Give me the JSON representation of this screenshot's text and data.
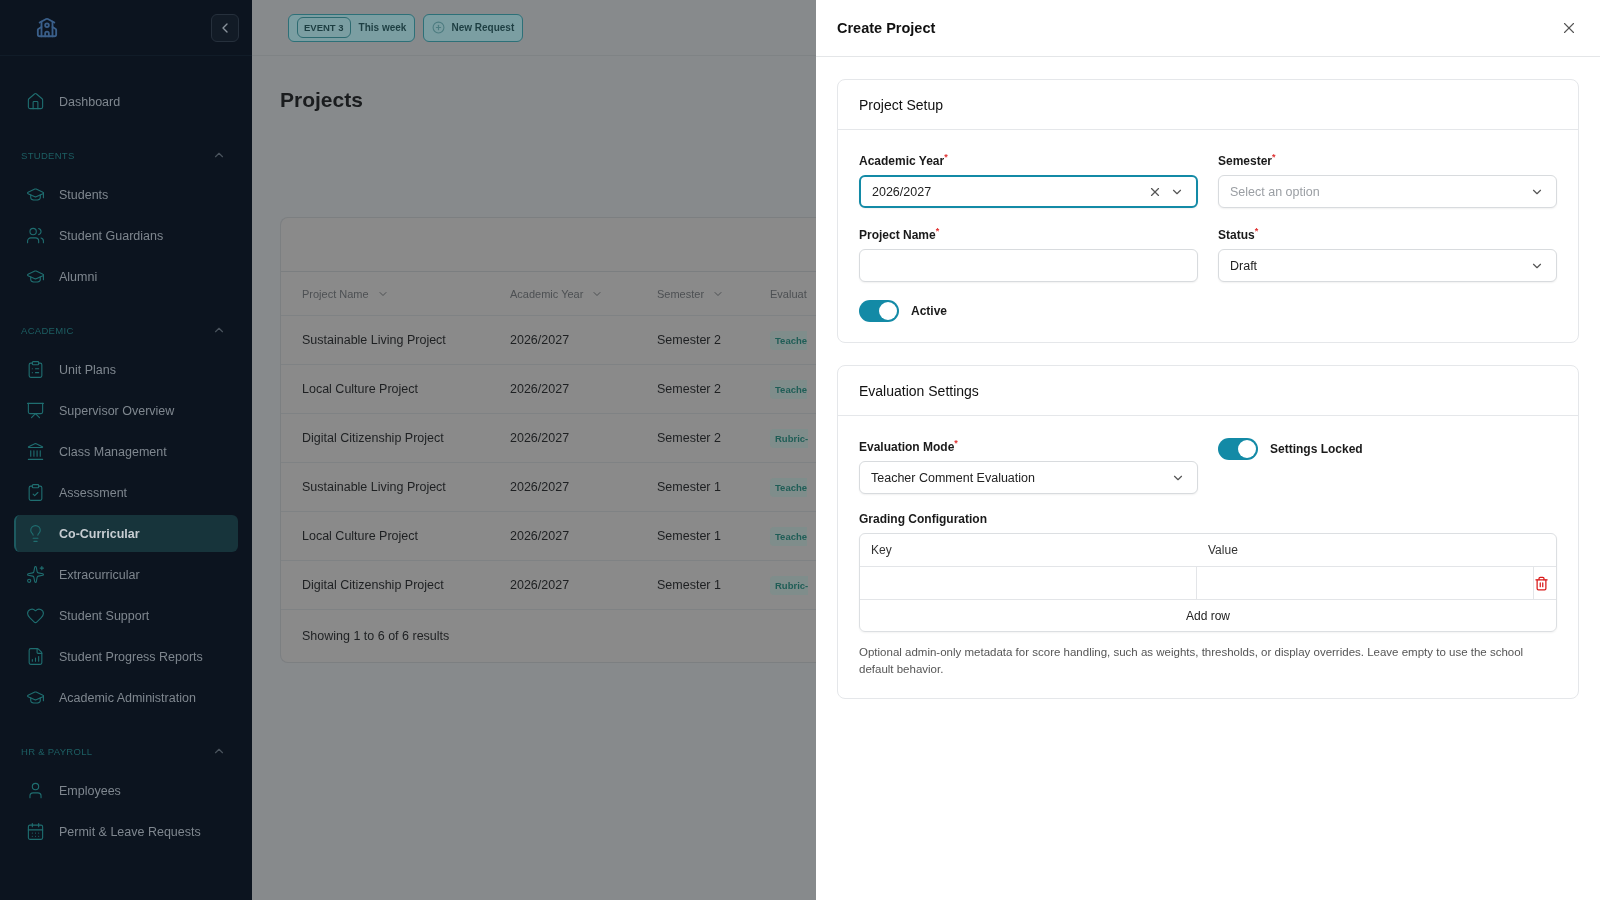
{
  "sidebar": {
    "top_items": [
      {
        "label": "Dashboard",
        "selected": false
      }
    ],
    "sections": [
      {
        "title": "STUDENTS",
        "expanded": true,
        "items": [
          {
            "label": "Students",
            "selected": false
          },
          {
            "label": "Student Guardians",
            "selected": false
          },
          {
            "label": "Alumni",
            "selected": false
          }
        ]
      },
      {
        "title": "ACADEMIC",
        "expanded": true,
        "items": [
          {
            "label": "Unit Plans",
            "selected": false
          },
          {
            "label": "Supervisor Overview",
            "selected": false
          },
          {
            "label": "Class Management",
            "selected": false
          },
          {
            "label": "Assessment",
            "selected": false
          },
          {
            "label": "Co-Curricular",
            "selected": true
          },
          {
            "label": "Extracurricular",
            "selected": false
          },
          {
            "label": "Student Support",
            "selected": false
          },
          {
            "label": "Student Progress Reports",
            "selected": false
          },
          {
            "label": "Academic Administration",
            "selected": false
          }
        ]
      },
      {
        "title": "HR & PAYROLL",
        "expanded": true,
        "items": [
          {
            "label": "Employees",
            "selected": false
          },
          {
            "label": "Permit & Leave Requests",
            "selected": false
          }
        ]
      }
    ]
  },
  "topbar": {
    "event_badge": "EVENT 3",
    "event_period": "This week",
    "new_request": "New Request"
  },
  "page": {
    "title": "Projects"
  },
  "table": {
    "columns": [
      {
        "label": "Project Name",
        "sortable": true
      },
      {
        "label": "Academic Year",
        "sortable": true
      },
      {
        "label": "Semester",
        "sortable": true
      },
      {
        "label": "Evaluat"
      }
    ],
    "rows": [
      {
        "cells": [
          "Sustainable Living Project",
          "2026/2027",
          "Semester 2"
        ],
        "tag": "Teache"
      },
      {
        "cells": [
          "Local Culture Project",
          "2026/2027",
          "Semester 2"
        ],
        "tag": "Teache"
      },
      {
        "cells": [
          "Digital Citizenship Project",
          "2026/2027",
          "Semester 2"
        ],
        "tag": "Rubric-"
      },
      {
        "cells": [
          "Sustainable Living Project",
          "2026/2027",
          "Semester 1"
        ],
        "tag": "Teache"
      },
      {
        "cells": [
          "Local Culture Project",
          "2026/2027",
          "Semester 1"
        ],
        "tag": "Teache"
      },
      {
        "cells": [
          "Digital Citizenship Project",
          "2026/2027",
          "Semester 1"
        ],
        "tag": "Rubric-"
      }
    ],
    "footer": "Showing 1 to 6 of 6 results"
  },
  "drawer": {
    "title": "Create Project",
    "sections": [
      {
        "title": "Project Setup",
        "fields": [
          {
            "kind": "select",
            "label": "Academic Year$^{*}$",
            "value": "2026/2027",
            "clearable": true,
            "focused": true
          },
          {
            "kind": "select",
            "label": "Semester$^{*}$",
            "placeholder": "Select an option",
            "clearable": false,
            "focused": false
          },
          {
            "kind": "text",
            "label": "Project Name$^{*}$",
            "focused": false
          },
          {
            "kind": "select",
            "label": "Status$^{*}$",
            "value": "Draft",
            "clearable": false,
            "focused": false
          },
          {
            "kind": "toggle",
            "label": "Active",
            "on": true
          }
        ]
      },
      {
        "title": "Evaluation Settings",
        "fields": [
          {
            "kind": "select",
            "label": "Evaluation Mode$^{*}$",
            "value": "Teacher Comment Evaluation",
            "clearable": false,
            "focused": false
          },
          {
            "kind": "toggle",
            "label": "Settings Locked",
            "on": true
          },
          {
            "kind": "keyvalue",
            "label": "Grading Configuration",
            "columns": [
              "Key",
              "Value"
            ],
            "add_label": "Add row",
            "help": "Optional admin-only metadata for score handling, such as weights, thresholds, or display overrides. Leave empty to use the school default behavior."
          }
        ]
      }
    ]
  }
}
